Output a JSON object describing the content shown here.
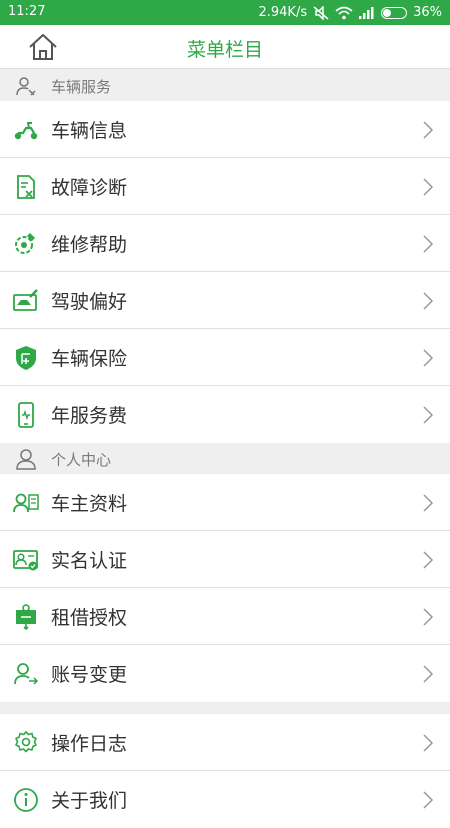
{
  "status_bar": {
    "time": "11:27",
    "speed": "2.94K/s",
    "battery": "36%",
    "battery_level": 0.36
  },
  "nav": {
    "title": "菜单栏目",
    "home_icon": "home-icon"
  },
  "sections": [
    {
      "title": "车辆服务",
      "icon": "user-settings-icon"
    },
    {
      "title": "个人中心",
      "icon": "user-icon"
    }
  ],
  "items": [
    {
      "label": "车辆信息",
      "icon": "scooter-icon"
    },
    {
      "label": "故障诊断",
      "icon": "diagnosis-icon"
    },
    {
      "label": "维修帮助",
      "icon": "repair-icon"
    },
    {
      "label": "驾驶偏好",
      "icon": "driving-preference-icon"
    },
    {
      "label": "车辆保险",
      "icon": "insurance-shield-icon"
    },
    {
      "label": "年服务费",
      "icon": "phone-fee-icon"
    },
    {
      "label": "车主资料",
      "icon": "owner-profile-icon"
    },
    {
      "label": "实名认证",
      "icon": "id-card-verified-icon"
    },
    {
      "label": "租借授权",
      "icon": "rental-authorization-icon"
    },
    {
      "label": "账号变更",
      "icon": "account-change-icon"
    },
    {
      "label": "操作日志",
      "icon": "gear-icon"
    },
    {
      "label": "关于我们",
      "icon": "info-icon"
    }
  ],
  "colors": {
    "accent": "#2fa847",
    "background": "#efefef"
  }
}
